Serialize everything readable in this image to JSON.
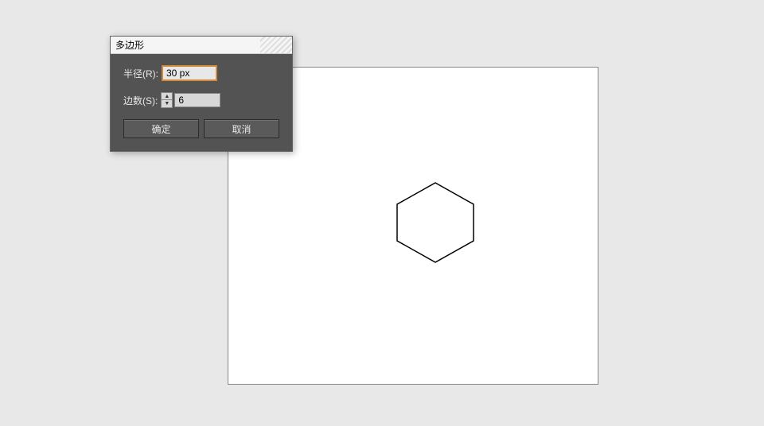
{
  "canvas": {
    "shape": {
      "type": "polygon",
      "sides": 6,
      "radius_px": 50,
      "stroke": "#000000",
      "fill": "none"
    }
  },
  "dialog": {
    "title": "多边形",
    "fields": {
      "radius": {
        "label": "半径(R):",
        "value": "30 px"
      },
      "sides": {
        "label": "边数(S):",
        "value": "6"
      }
    },
    "buttons": {
      "ok": "确定",
      "cancel": "取消"
    }
  }
}
